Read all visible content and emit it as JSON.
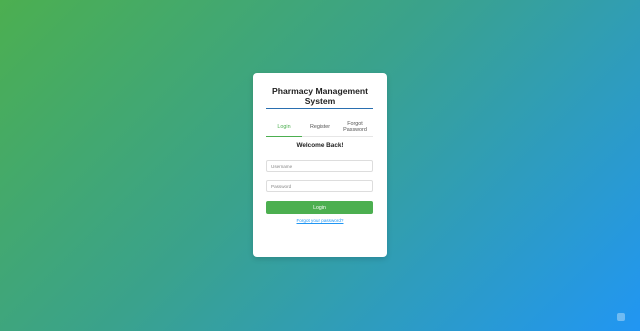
{
  "app": {
    "title_line1": "Pharmacy Management",
    "title_line2": "System"
  },
  "tabs": [
    {
      "label": "Login",
      "active": true
    },
    {
      "label": "Register",
      "active": false
    },
    {
      "label_line1": "Forgot",
      "label_line2": "Password",
      "active": false
    }
  ],
  "form": {
    "heading": "Welcome Back!",
    "username_placeholder": "Username",
    "password_placeholder": "Password",
    "submit_label": "Login",
    "forgot_link": "Forgot your password?"
  },
  "colors": {
    "accent": "#4caf50",
    "title_rule": "#2a6fb0",
    "link": "#2196f3",
    "gradient_start": "#4caf50",
    "gradient_end": "#2196f3"
  }
}
